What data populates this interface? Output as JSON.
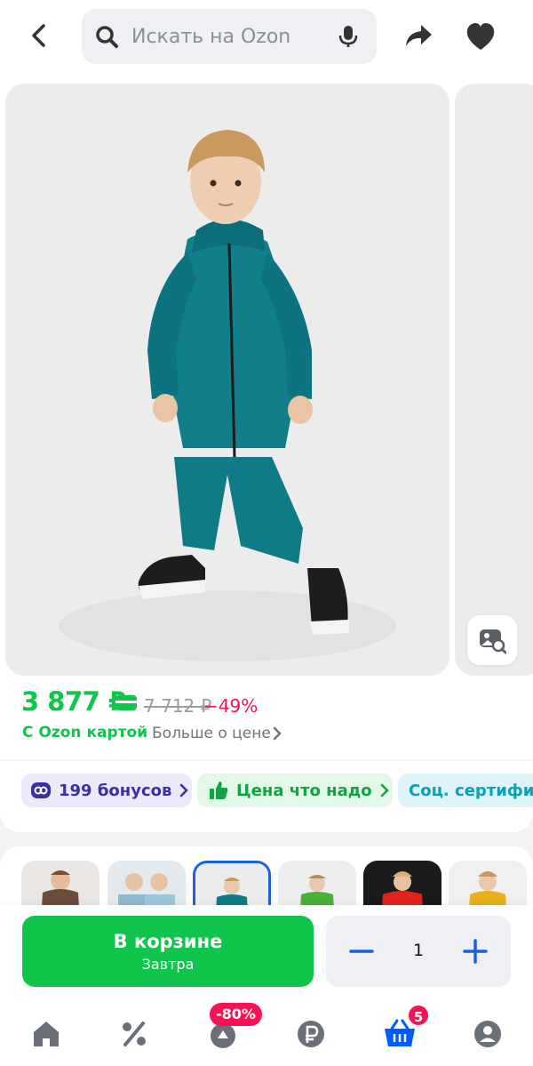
{
  "search": {
    "placeholder": "Искать на Ozon"
  },
  "icons": {
    "back": "chevron-left-icon",
    "search": "search-icon",
    "mic": "microphone-icon",
    "share": "share-icon",
    "favorite": "heart-icon",
    "visual_search": "image-search-icon"
  },
  "price": {
    "current": "3 877 ₽",
    "old": "7 712 ₽",
    "discount": "−49%",
    "ozon_card_label": "С Ozon картой",
    "more_label": "Больше о цене"
  },
  "chips": [
    {
      "label": "199 бонусов",
      "icon": "bonus-icon"
    },
    {
      "label": "Цена что надо",
      "icon": "thumbs-up-icon"
    },
    {
      "label": "Соц. сертифи",
      "icon": ""
    }
  ],
  "variants": [
    {
      "color": "brown"
    },
    {
      "color": "light-blue"
    },
    {
      "color": "teal",
      "selected": true
    },
    {
      "color": "green"
    },
    {
      "color": "red"
    },
    {
      "color": "yellow"
    }
  ],
  "cart": {
    "label": "В корзине",
    "delivery": "Завтра",
    "quantity": "1"
  },
  "nav": {
    "items": [
      "home-icon",
      "percent-icon",
      "fresh-icon",
      "ruble-icon",
      "cart-icon",
      "profile-icon"
    ],
    "sale_badge": "-80%",
    "cart_badge": "5"
  },
  "colors": {
    "green": "#10c44c",
    "pink": "#f91155",
    "blue": "#1b5fe0",
    "product_teal": "#0f7b87"
  }
}
